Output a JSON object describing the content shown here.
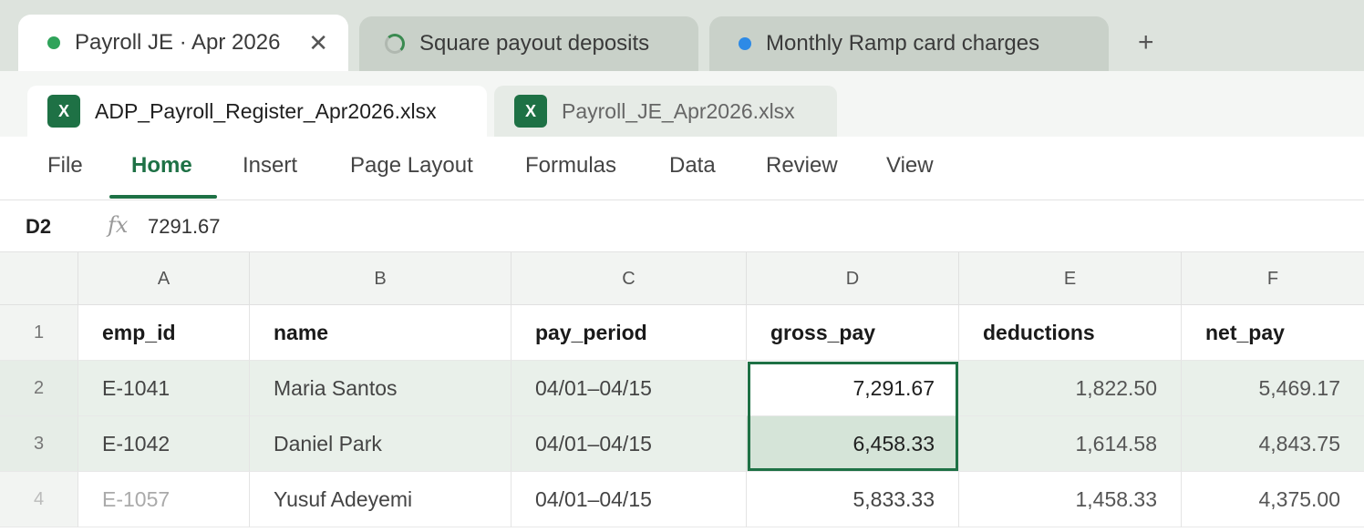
{
  "browser_tabs": [
    {
      "label": "Payroll JE · Apr 2026",
      "status_color": "#2fa35a",
      "active": true
    },
    {
      "label": "Square payout deposits",
      "loading": true
    },
    {
      "label": "Monthly Ramp card charges",
      "status_color": "#2d8ae6"
    }
  ],
  "new_tab": "+",
  "close": "✕",
  "files": [
    {
      "label": "ADP_Payroll_Register_Apr2026.xlsx",
      "icon": "X"
    },
    {
      "label": "Payroll_JE_Apr2026.xlsx",
      "icon": "X"
    }
  ],
  "ribbon": [
    "File",
    "Home",
    "Insert",
    "Page Layout",
    "Formulas",
    "Data",
    "Review",
    "View"
  ],
  "formula_bar": {
    "cell": "D2",
    "fx": "fx",
    "value": "7291.67"
  },
  "columns": [
    "A",
    "B",
    "C",
    "D",
    "E",
    "F"
  ],
  "rows": [
    {
      "n": "1",
      "cells": [
        "emp_id",
        "name",
        "pay_period",
        "gross_pay",
        "deductions",
        "net_pay"
      ]
    },
    {
      "n": "2",
      "cells": [
        "E-1041",
        "Maria Santos",
        "04/01–04/15",
        "7,291.67",
        "1,822.50",
        "5,469.17"
      ]
    },
    {
      "n": "3",
      "cells": [
        "E-1042",
        "Daniel Park",
        "04/01–04/15",
        "6,458.33",
        "1,614.58",
        "4,843.75"
      ]
    },
    {
      "n": "4",
      "cells": [
        "E-1057",
        "Yusuf Adeyemi",
        "04/01–04/15",
        "5,833.33",
        "1,458.33",
        "4,375.00"
      ]
    }
  ]
}
